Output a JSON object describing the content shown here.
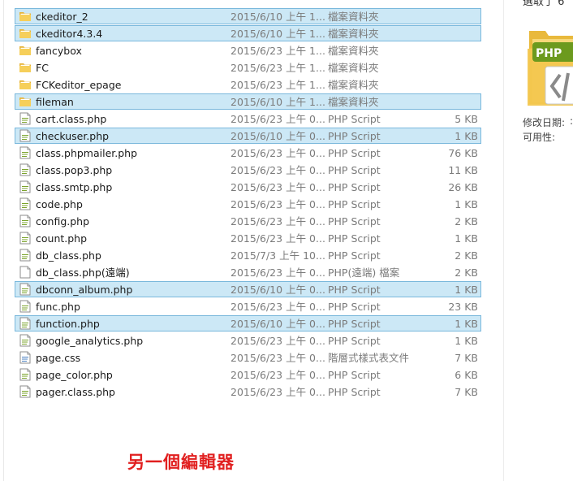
{
  "files": [
    {
      "name": "ckeditor_2",
      "date": "2015/6/10 上午 1...",
      "type": "檔案資料夾",
      "size": "",
      "icon": "folder-icon",
      "selected": true
    },
    {
      "name": "ckeditor4.3.4",
      "date": "2015/6/10 上午 1...",
      "type": "檔案資料夾",
      "size": "",
      "icon": "folder-icon",
      "selected": true
    },
    {
      "name": "fancybox",
      "date": "2015/6/23 上午 1...",
      "type": "檔案資料夾",
      "size": "",
      "icon": "folder-icon",
      "selected": false
    },
    {
      "name": "FC",
      "date": "2015/6/23 上午 1...",
      "type": "檔案資料夾",
      "size": "",
      "icon": "folder-icon",
      "selected": false
    },
    {
      "name": "FCKeditor_epage",
      "date": "2015/6/23 上午 1...",
      "type": "檔案資料夾",
      "size": "",
      "icon": "folder-icon",
      "selected": false
    },
    {
      "name": "fileman",
      "date": "2015/6/10 上午 1...",
      "type": "檔案資料夾",
      "size": "",
      "icon": "folder-icon",
      "selected": true
    },
    {
      "name": "cart.class.php",
      "date": "2015/6/23 上午 0...",
      "type": "PHP Script",
      "size": "5 KB",
      "icon": "php-file-icon",
      "selected": false
    },
    {
      "name": "checkuser.php",
      "date": "2015/6/10 上午 0...",
      "type": "PHP Script",
      "size": "1 KB",
      "icon": "php-file-icon",
      "selected": true
    },
    {
      "name": "class.phpmailer.php",
      "date": "2015/6/23 上午 0...",
      "type": "PHP Script",
      "size": "76 KB",
      "icon": "php-file-icon",
      "selected": false
    },
    {
      "name": "class.pop3.php",
      "date": "2015/6/23 上午 0...",
      "type": "PHP Script",
      "size": "11 KB",
      "icon": "php-file-icon",
      "selected": false
    },
    {
      "name": "class.smtp.php",
      "date": "2015/6/23 上午 0...",
      "type": "PHP Script",
      "size": "26 KB",
      "icon": "php-file-icon",
      "selected": false
    },
    {
      "name": "code.php",
      "date": "2015/6/23 上午 0...",
      "type": "PHP Script",
      "size": "1 KB",
      "icon": "php-file-icon",
      "selected": false
    },
    {
      "name": "config.php",
      "date": "2015/6/23 上午 0...",
      "type": "PHP Script",
      "size": "2 KB",
      "icon": "php-file-icon",
      "selected": false
    },
    {
      "name": "count.php",
      "date": "2015/6/23 上午 0...",
      "type": "PHP Script",
      "size": "1 KB",
      "icon": "php-file-icon",
      "selected": false
    },
    {
      "name": "db_class.php",
      "date": "2015/7/3 上午 10...",
      "type": "PHP Script",
      "size": "2 KB",
      "icon": "php-file-icon",
      "selected": false
    },
    {
      "name": "db_class.php(遠端)",
      "date": "2015/6/23 上午 0...",
      "type": "PHP(遠端) 檔案",
      "size": "2 KB",
      "icon": "blank-file-icon",
      "selected": false
    },
    {
      "name": "dbconn_album.php",
      "date": "2015/6/10 上午 0...",
      "type": "PHP Script",
      "size": "1 KB",
      "icon": "php-file-icon",
      "selected": true
    },
    {
      "name": "func.php",
      "date": "2015/6/23 上午 0...",
      "type": "PHP Script",
      "size": "23 KB",
      "icon": "php-file-icon",
      "selected": false
    },
    {
      "name": "function.php",
      "date": "2015/6/10 上午 0...",
      "type": "PHP Script",
      "size": "1 KB",
      "icon": "php-file-icon",
      "selected": true
    },
    {
      "name": "google_analytics.php",
      "date": "2015/6/23 上午 0...",
      "type": "PHP Script",
      "size": "1 KB",
      "icon": "php-file-icon",
      "selected": false
    },
    {
      "name": "page.css",
      "date": "2015/6/23 上午 0...",
      "type": "階層式樣式表文件",
      "size": "7 KB",
      "icon": "css-file-icon",
      "selected": false
    },
    {
      "name": "page_color.php",
      "date": "2015/6/23 上午 0...",
      "type": "PHP Script",
      "size": "6 KB",
      "icon": "php-file-icon",
      "selected": false
    },
    {
      "name": "pager.class.php",
      "date": "2015/6/23 上午 0...",
      "type": "PHP Script",
      "size": "7 KB",
      "icon": "php-file-icon",
      "selected": false
    }
  ],
  "details_pane": {
    "top_text": "選取了 6",
    "thumbnail_badge": "PHP",
    "thumbnail_icon": "php-folder-thumbnail-icon",
    "modified_label": "修改日期:",
    "availability_label": "可用性:"
  },
  "caption": "另一個編輯器",
  "colors": {
    "selection_fill": "#cce8f6",
    "selection_border": "#7ab8dc",
    "caption_red": "#e12020",
    "php_badge_green": "#6c9a1e",
    "folder_yellow": "#f3c74f"
  }
}
